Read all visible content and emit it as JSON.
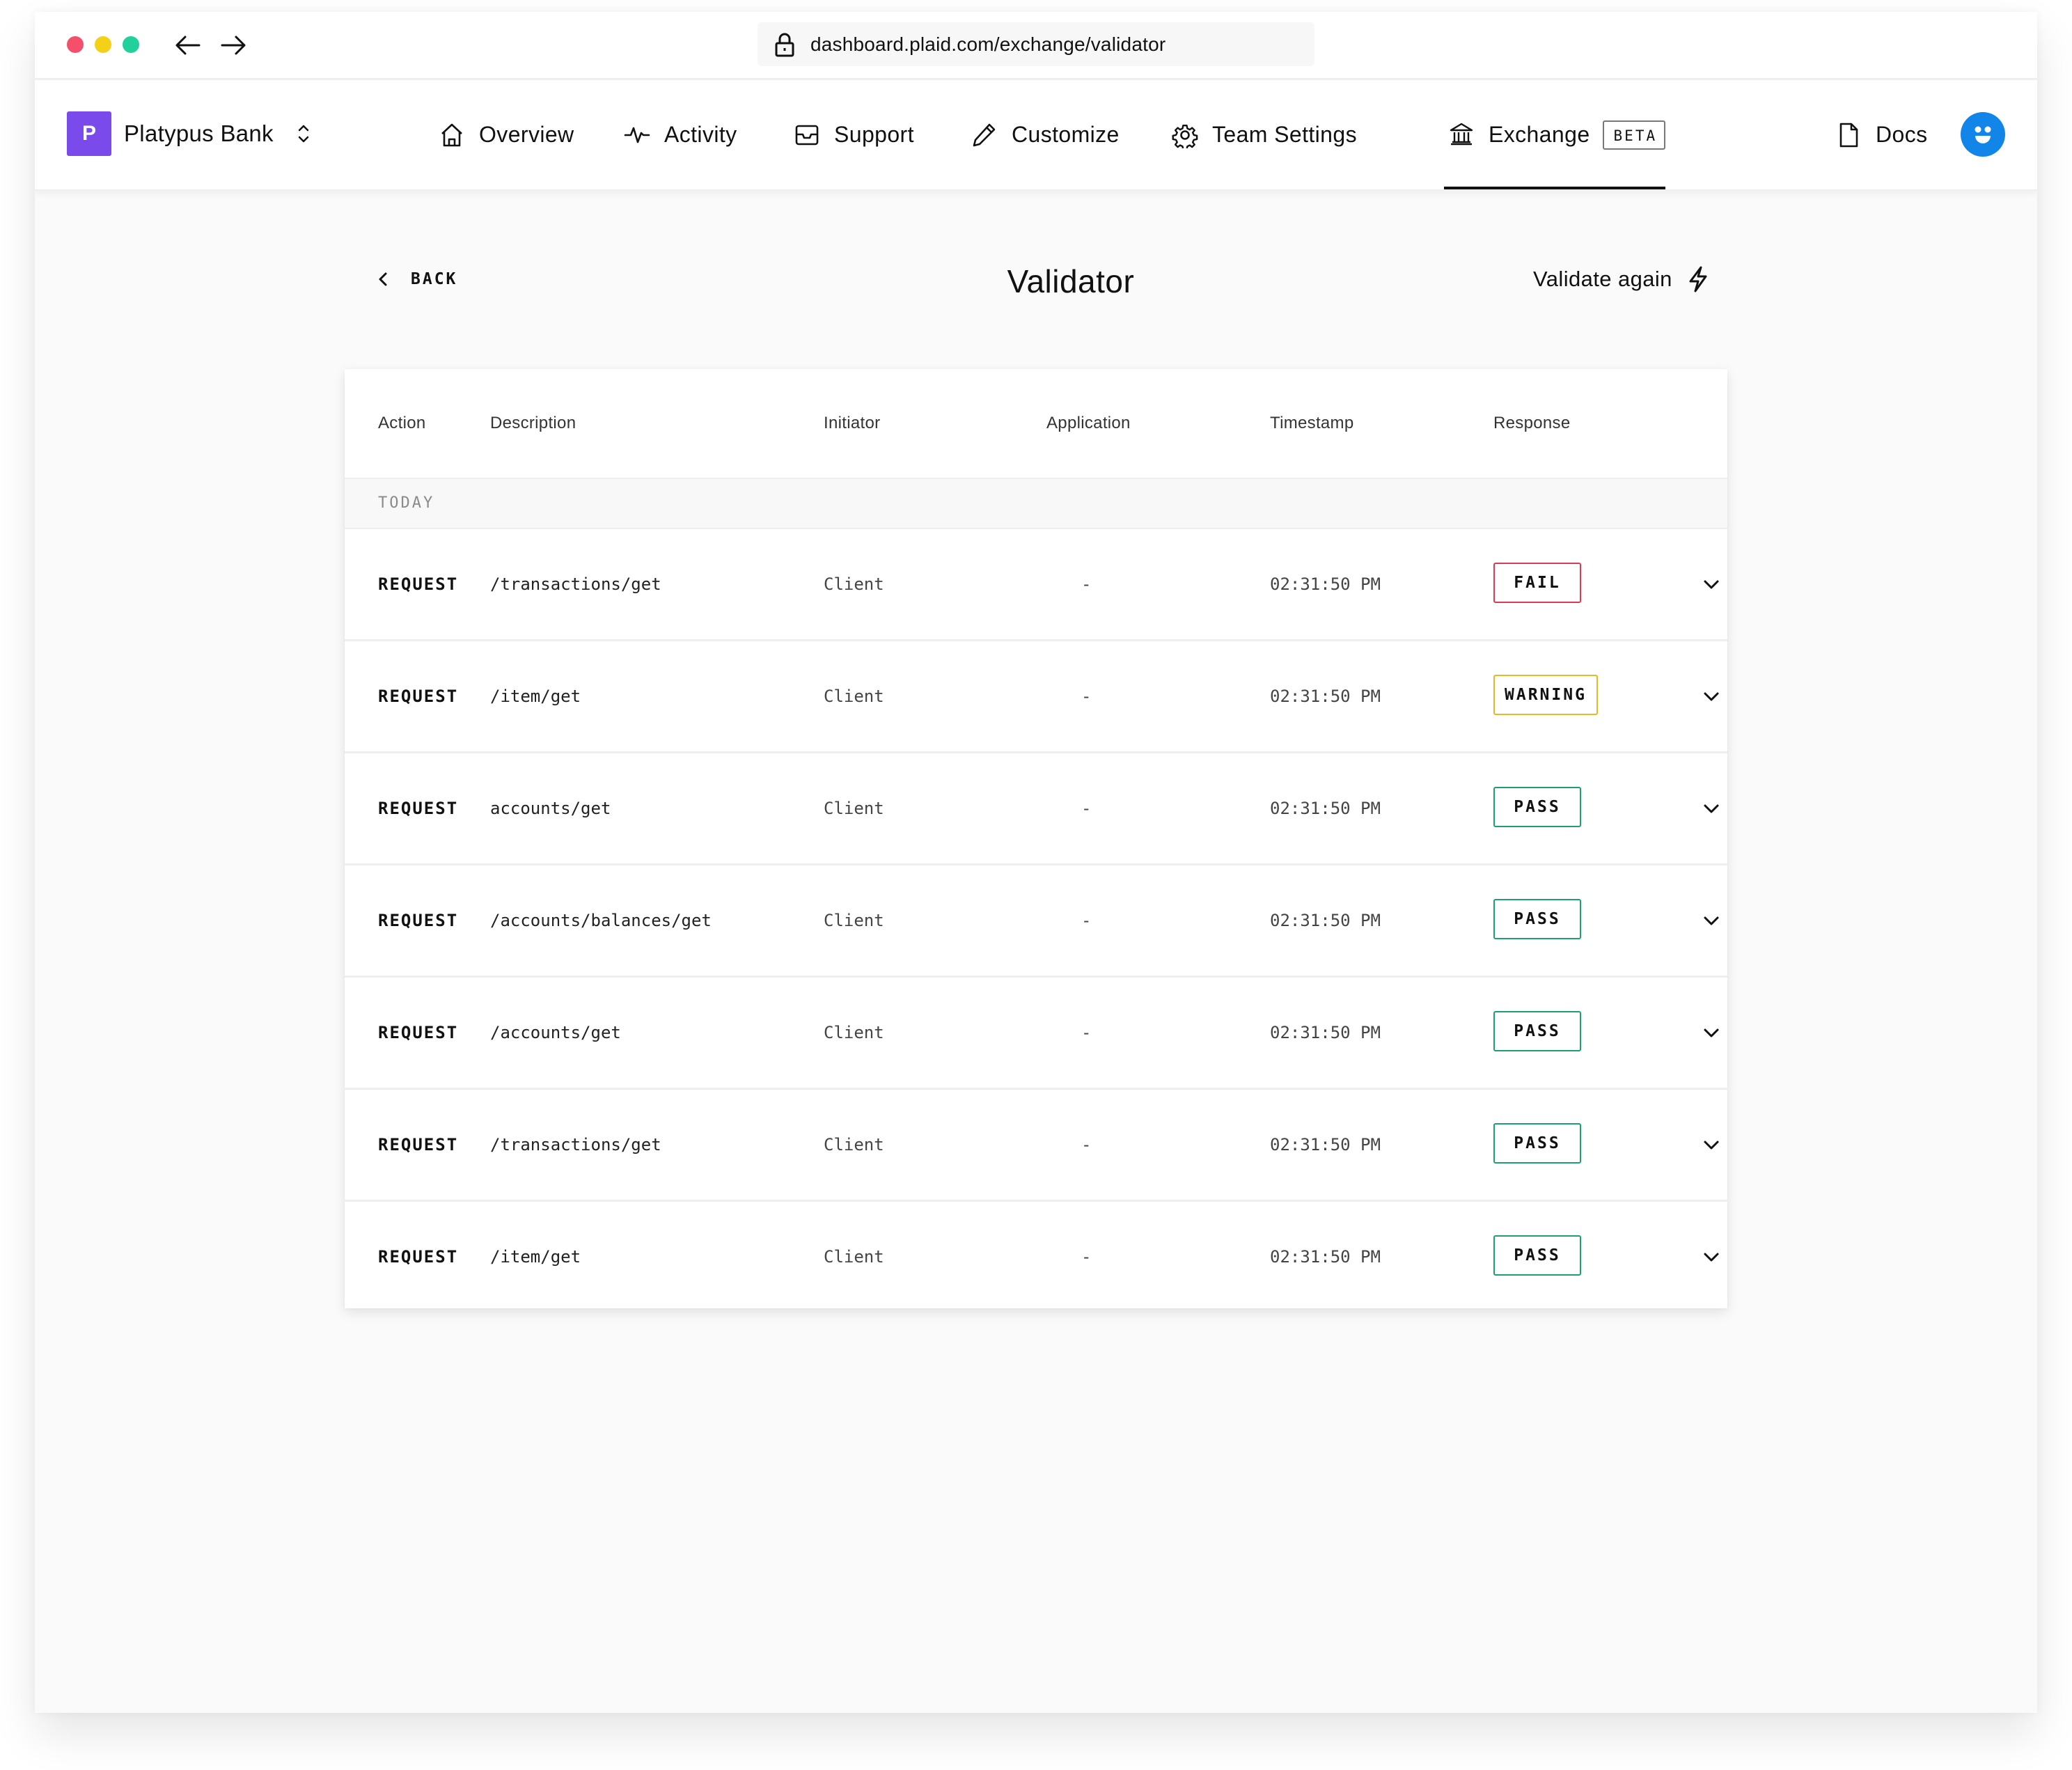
{
  "browser": {
    "url": "dashboard.plaid.com/exchange/validator",
    "traffic_lights": {
      "close": "#f5506a",
      "minimize": "#f2d118",
      "maximize": "#22d09b"
    }
  },
  "header": {
    "org": {
      "initial": "P",
      "name": "Platypus Bank",
      "logo_color": "#7a4aea"
    },
    "nav": [
      {
        "label": "Overview",
        "icon": "home-icon"
      },
      {
        "label": "Activity",
        "icon": "activity-icon"
      },
      {
        "label": "Support",
        "icon": "inbox-icon"
      },
      {
        "label": "Customize",
        "icon": "pencil-icon"
      },
      {
        "label": "Team Settings",
        "icon": "gear-icon"
      },
      {
        "label": "Exchange",
        "icon": "bank-icon",
        "badge": "BETA",
        "active": true
      }
    ],
    "docs_label": "Docs",
    "avatar_color": "#1285e8"
  },
  "page": {
    "back_label": "BACK",
    "title": "Validator",
    "validate_label": "Validate again"
  },
  "table": {
    "columns": [
      "Action",
      "Description",
      "Initiator",
      "Application",
      "Timestamp",
      "Response"
    ],
    "group_label": "TODAY",
    "rows": [
      {
        "action": "REQUEST",
        "description": "/transactions/get",
        "initiator": "Client",
        "application": "-",
        "timestamp": "02:31:50 PM",
        "response": "FAIL"
      },
      {
        "action": "REQUEST",
        "description": "/item/get",
        "initiator": "Client",
        "application": "-",
        "timestamp": "02:31:50 PM",
        "response": "WARNING"
      },
      {
        "action": "REQUEST",
        "description": "accounts/get",
        "initiator": "Client",
        "application": "-",
        "timestamp": "02:31:50 PM",
        "response": "PASS"
      },
      {
        "action": "REQUEST",
        "description": "/accounts/balances/get",
        "initiator": "Client",
        "application": "-",
        "timestamp": "02:31:50 PM",
        "response": "PASS"
      },
      {
        "action": "REQUEST",
        "description": "/accounts/get",
        "initiator": "Client",
        "application": "-",
        "timestamp": "02:31:50 PM",
        "response": "PASS"
      },
      {
        "action": "REQUEST",
        "description": "/transactions/get",
        "initiator": "Client",
        "application": "-",
        "timestamp": "02:31:50 PM",
        "response": "PASS"
      },
      {
        "action": "REQUEST",
        "description": "/item/get",
        "initiator": "Client",
        "application": "-",
        "timestamp": "02:31:50 PM",
        "response": "PASS"
      }
    ],
    "status_colors": {
      "FAIL": "#dd3a57",
      "WARNING": "#e8b825",
      "PASS": "#1f9e74"
    }
  }
}
